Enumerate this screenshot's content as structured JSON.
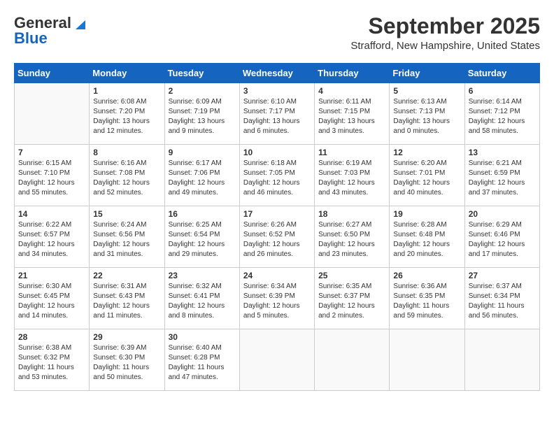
{
  "header": {
    "logo_line1": "General",
    "logo_line2": "Blue",
    "month": "September 2025",
    "location": "Strafford, New Hampshire, United States"
  },
  "weekdays": [
    "Sunday",
    "Monday",
    "Tuesday",
    "Wednesday",
    "Thursday",
    "Friday",
    "Saturday"
  ],
  "weeks": [
    [
      {
        "day": "",
        "info": ""
      },
      {
        "day": "1",
        "info": "Sunrise: 6:08 AM\nSunset: 7:20 PM\nDaylight: 13 hours\nand 12 minutes."
      },
      {
        "day": "2",
        "info": "Sunrise: 6:09 AM\nSunset: 7:19 PM\nDaylight: 13 hours\nand 9 minutes."
      },
      {
        "day": "3",
        "info": "Sunrise: 6:10 AM\nSunset: 7:17 PM\nDaylight: 13 hours\nand 6 minutes."
      },
      {
        "day": "4",
        "info": "Sunrise: 6:11 AM\nSunset: 7:15 PM\nDaylight: 13 hours\nand 3 minutes."
      },
      {
        "day": "5",
        "info": "Sunrise: 6:13 AM\nSunset: 7:13 PM\nDaylight: 13 hours\nand 0 minutes."
      },
      {
        "day": "6",
        "info": "Sunrise: 6:14 AM\nSunset: 7:12 PM\nDaylight: 12 hours\nand 58 minutes."
      }
    ],
    [
      {
        "day": "7",
        "info": "Sunrise: 6:15 AM\nSunset: 7:10 PM\nDaylight: 12 hours\nand 55 minutes."
      },
      {
        "day": "8",
        "info": "Sunrise: 6:16 AM\nSunset: 7:08 PM\nDaylight: 12 hours\nand 52 minutes."
      },
      {
        "day": "9",
        "info": "Sunrise: 6:17 AM\nSunset: 7:06 PM\nDaylight: 12 hours\nand 49 minutes."
      },
      {
        "day": "10",
        "info": "Sunrise: 6:18 AM\nSunset: 7:05 PM\nDaylight: 12 hours\nand 46 minutes."
      },
      {
        "day": "11",
        "info": "Sunrise: 6:19 AM\nSunset: 7:03 PM\nDaylight: 12 hours\nand 43 minutes."
      },
      {
        "day": "12",
        "info": "Sunrise: 6:20 AM\nSunset: 7:01 PM\nDaylight: 12 hours\nand 40 minutes."
      },
      {
        "day": "13",
        "info": "Sunrise: 6:21 AM\nSunset: 6:59 PM\nDaylight: 12 hours\nand 37 minutes."
      }
    ],
    [
      {
        "day": "14",
        "info": "Sunrise: 6:22 AM\nSunset: 6:57 PM\nDaylight: 12 hours\nand 34 minutes."
      },
      {
        "day": "15",
        "info": "Sunrise: 6:24 AM\nSunset: 6:56 PM\nDaylight: 12 hours\nand 31 minutes."
      },
      {
        "day": "16",
        "info": "Sunrise: 6:25 AM\nSunset: 6:54 PM\nDaylight: 12 hours\nand 29 minutes."
      },
      {
        "day": "17",
        "info": "Sunrise: 6:26 AM\nSunset: 6:52 PM\nDaylight: 12 hours\nand 26 minutes."
      },
      {
        "day": "18",
        "info": "Sunrise: 6:27 AM\nSunset: 6:50 PM\nDaylight: 12 hours\nand 23 minutes."
      },
      {
        "day": "19",
        "info": "Sunrise: 6:28 AM\nSunset: 6:48 PM\nDaylight: 12 hours\nand 20 minutes."
      },
      {
        "day": "20",
        "info": "Sunrise: 6:29 AM\nSunset: 6:46 PM\nDaylight: 12 hours\nand 17 minutes."
      }
    ],
    [
      {
        "day": "21",
        "info": "Sunrise: 6:30 AM\nSunset: 6:45 PM\nDaylight: 12 hours\nand 14 minutes."
      },
      {
        "day": "22",
        "info": "Sunrise: 6:31 AM\nSunset: 6:43 PM\nDaylight: 12 hours\nand 11 minutes."
      },
      {
        "day": "23",
        "info": "Sunrise: 6:32 AM\nSunset: 6:41 PM\nDaylight: 12 hours\nand 8 minutes."
      },
      {
        "day": "24",
        "info": "Sunrise: 6:34 AM\nSunset: 6:39 PM\nDaylight: 12 hours\nand 5 minutes."
      },
      {
        "day": "25",
        "info": "Sunrise: 6:35 AM\nSunset: 6:37 PM\nDaylight: 12 hours\nand 2 minutes."
      },
      {
        "day": "26",
        "info": "Sunrise: 6:36 AM\nSunset: 6:35 PM\nDaylight: 11 hours\nand 59 minutes."
      },
      {
        "day": "27",
        "info": "Sunrise: 6:37 AM\nSunset: 6:34 PM\nDaylight: 11 hours\nand 56 minutes."
      }
    ],
    [
      {
        "day": "28",
        "info": "Sunrise: 6:38 AM\nSunset: 6:32 PM\nDaylight: 11 hours\nand 53 minutes."
      },
      {
        "day": "29",
        "info": "Sunrise: 6:39 AM\nSunset: 6:30 PM\nDaylight: 11 hours\nand 50 minutes."
      },
      {
        "day": "30",
        "info": "Sunrise: 6:40 AM\nSunset: 6:28 PM\nDaylight: 11 hours\nand 47 minutes."
      },
      {
        "day": "",
        "info": ""
      },
      {
        "day": "",
        "info": ""
      },
      {
        "day": "",
        "info": ""
      },
      {
        "day": "",
        "info": ""
      }
    ]
  ]
}
